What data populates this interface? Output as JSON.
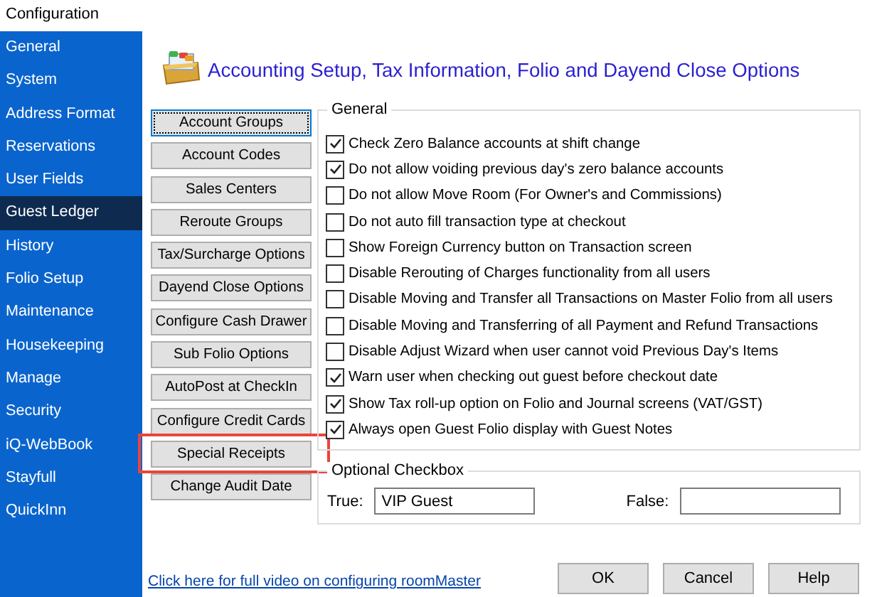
{
  "window": {
    "title": "Configuration"
  },
  "sidebar": {
    "items": [
      {
        "label": "General",
        "selected": false
      },
      {
        "label": "System",
        "selected": false
      },
      {
        "label": "Address Format",
        "selected": false
      },
      {
        "label": "Reservations",
        "selected": false
      },
      {
        "label": "User Fields",
        "selected": false
      },
      {
        "label": "Guest Ledger",
        "selected": true
      },
      {
        "label": "History",
        "selected": false
      },
      {
        "label": "Folio Setup",
        "selected": false
      },
      {
        "label": "Maintenance",
        "selected": false
      },
      {
        "label": "Housekeeping",
        "selected": false
      },
      {
        "label": "Manage",
        "selected": false
      },
      {
        "label": "Security",
        "selected": false
      },
      {
        "label": "iQ-WebBook",
        "selected": false
      },
      {
        "label": "Stayfull",
        "selected": false
      },
      {
        "label": "QuickInn",
        "selected": false
      }
    ]
  },
  "header": {
    "title": "Accounting Setup, Tax Information, Folio and Dayend Close Options"
  },
  "option_buttons": [
    {
      "label": "Account Groups",
      "focused": true,
      "highlighted": false
    },
    {
      "label": "Account Codes",
      "focused": false,
      "highlighted": false
    },
    {
      "label": "Sales Centers",
      "focused": false,
      "highlighted": false
    },
    {
      "label": "Reroute Groups",
      "focused": false,
      "highlighted": false
    },
    {
      "label": "Tax/Surcharge Options",
      "focused": false,
      "highlighted": false
    },
    {
      "label": "Dayend Close Options",
      "focused": false,
      "highlighted": false
    },
    {
      "label": "Configure Cash Drawer",
      "focused": false,
      "highlighted": false
    },
    {
      "label": "Sub Folio Options",
      "focused": false,
      "highlighted": false
    },
    {
      "label": "AutoPost at CheckIn",
      "focused": false,
      "highlighted": false
    },
    {
      "label": "Configure Credit Cards",
      "focused": false,
      "highlighted": false
    },
    {
      "label": "Special Receipts",
      "focused": false,
      "highlighted": true
    },
    {
      "label": "Change Audit Date",
      "focused": false,
      "highlighted": false
    }
  ],
  "general": {
    "legend": "General",
    "options": [
      {
        "label": "Check Zero Balance accounts at shift change",
        "checked": true
      },
      {
        "label": "Do not allow voiding previous day's zero balance accounts",
        "checked": true
      },
      {
        "label": "Do not allow Move Room (For Owner's and Commissions)",
        "checked": false
      },
      {
        "label": "Do not auto fill transaction type at checkout",
        "checked": false
      },
      {
        "label": "Show Foreign Currency button on Transaction screen",
        "checked": false
      },
      {
        "label": "Disable Rerouting of Charges functionality from all users",
        "checked": false
      },
      {
        "label": "Disable Moving and Transfer all Transactions on Master Folio from all users",
        "checked": false
      },
      {
        "label": "Disable Moving and Transferring of all Payment and Refund Transactions",
        "checked": false
      },
      {
        "label": "Disable Adjust Wizard when user cannot void Previous Day's Items",
        "checked": false
      },
      {
        "label": "Warn user when checking out guest before checkout date",
        "checked": true
      },
      {
        "label": "Show Tax roll-up option on Folio and Journal screens (VAT/GST)",
        "checked": true
      },
      {
        "label": "Always open Guest Folio display with Guest Notes",
        "checked": true
      }
    ]
  },
  "optional_checkbox": {
    "legend": "Optional Checkbox",
    "true_label": "True:",
    "true_value": "VIP Guest",
    "false_label": "False:"
  },
  "footer": {
    "link": "Click here for full video on configuring roomMaster",
    "buttons": [
      "OK",
      "Cancel",
      "Help"
    ]
  }
}
